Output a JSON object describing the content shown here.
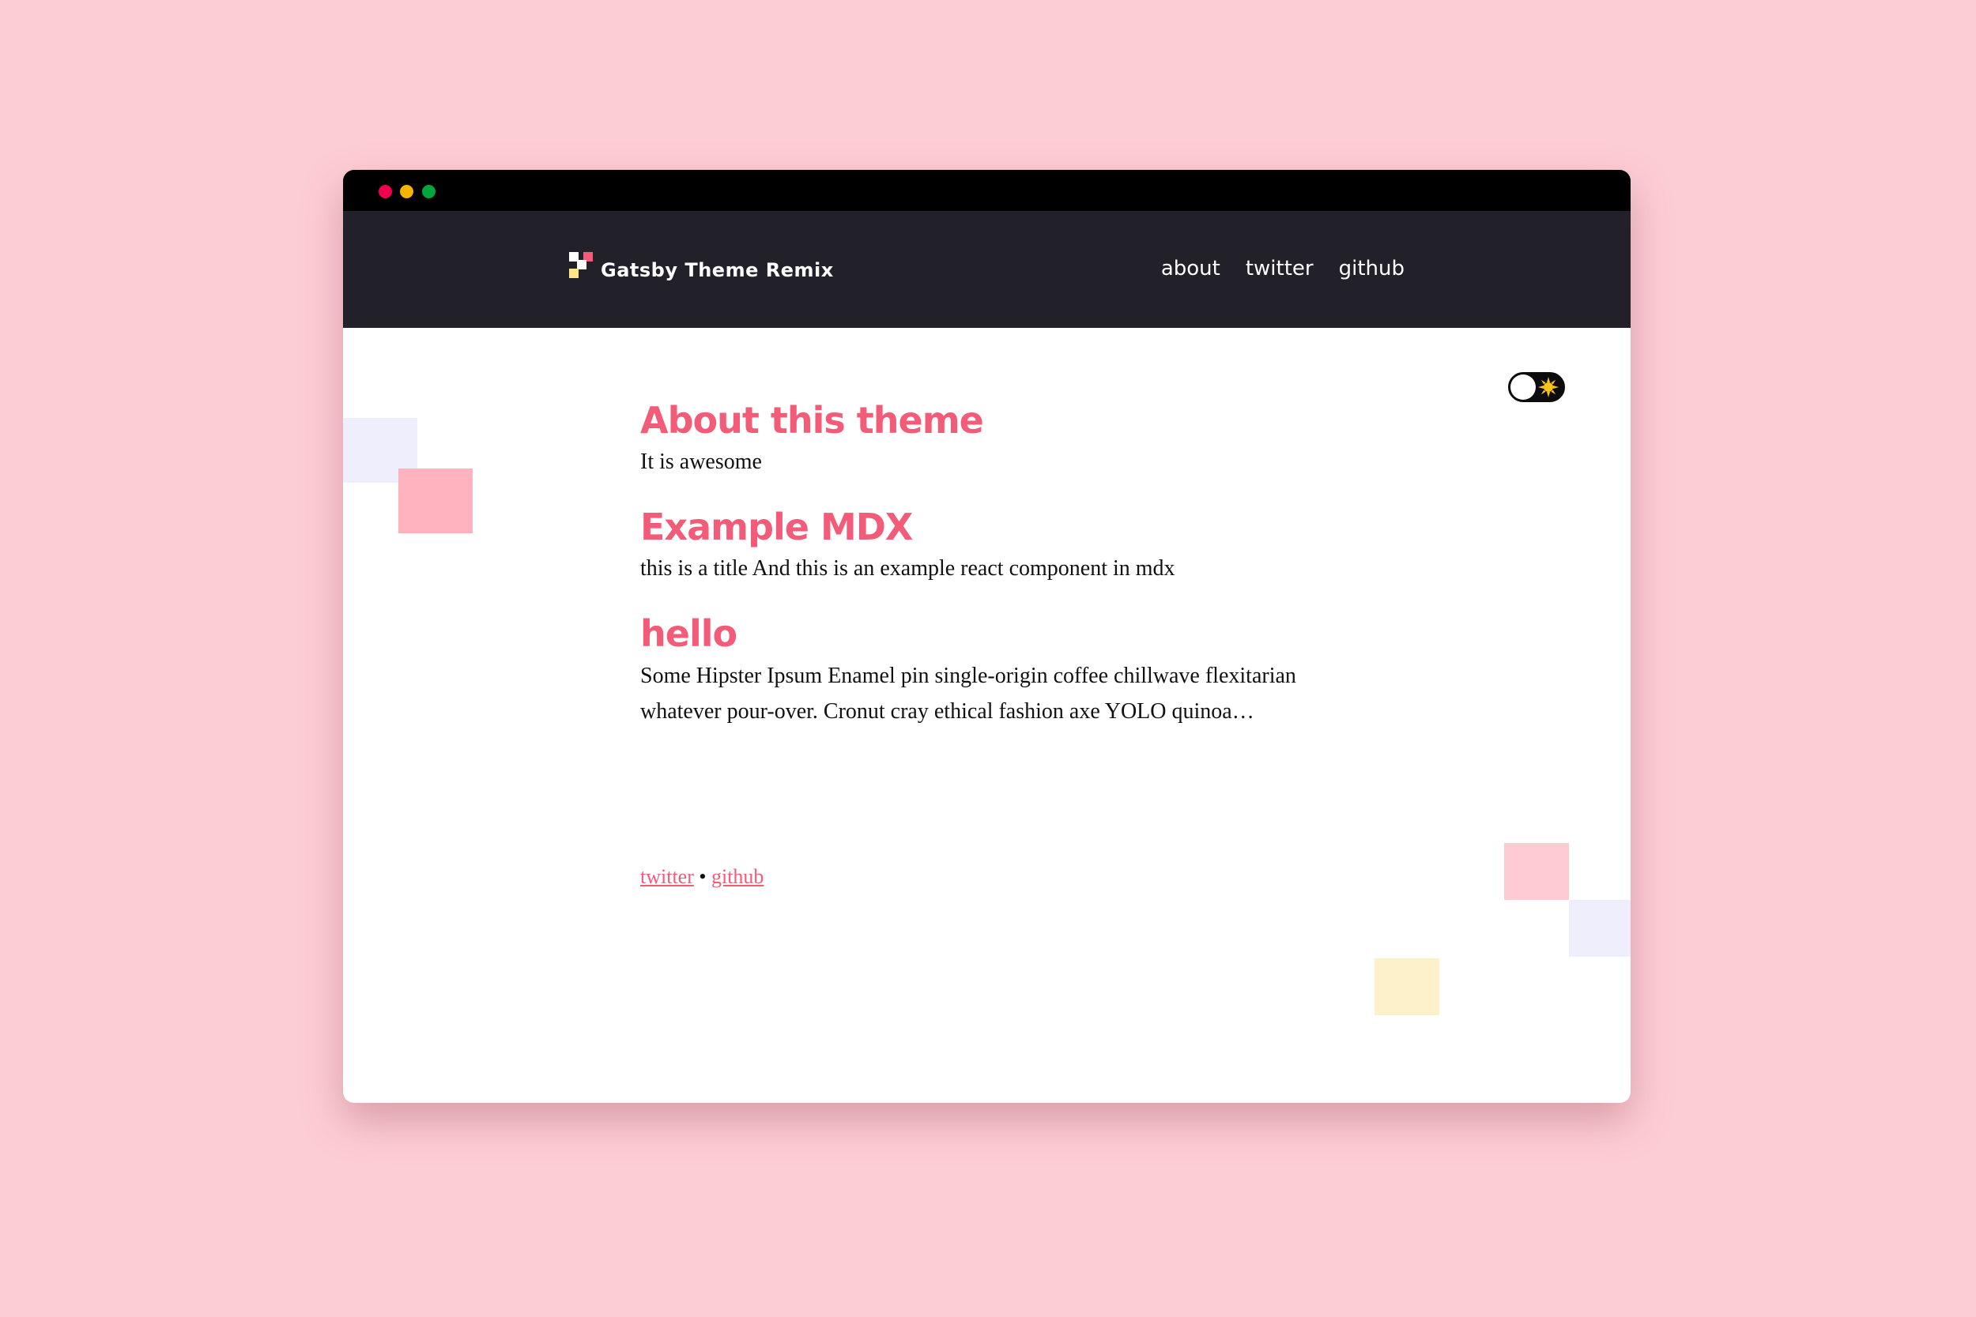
{
  "colors": {
    "page_background": "#fdcdd4",
    "header_background": "#222129",
    "accent": "#f25c78",
    "dot_red": "#f1004f",
    "dot_yellow": "#f5b400",
    "dot_green": "#00a63e",
    "deco_lavender": "#efeefd",
    "deco_pink": "#ffb3bf",
    "deco_light_pink": "#ffcbd2",
    "deco_cream": "#fdf1cc",
    "logo_white": "#ffffff",
    "logo_pink": "#f25c78",
    "logo_yellow": "#fde68a",
    "sun": "#fcc419"
  },
  "header": {
    "logo_icon": "pixel-logo-icon",
    "title": "Gatsby Theme Remix",
    "nav": [
      {
        "label": "about"
      },
      {
        "label": "twitter"
      },
      {
        "label": "github"
      }
    ]
  },
  "toggle": {
    "icon": "sun-icon",
    "state": "light"
  },
  "posts": [
    {
      "title": "About this theme",
      "excerpt": "It is awesome"
    },
    {
      "title": "Example MDX",
      "excerpt": "this is a title And this is an example react component in mdx"
    },
    {
      "title": "hello",
      "excerpt": "Some Hipster Ipsum Enamel pin single-origin coffee chillwave flexitarian whatever pour-over. Cronut cray ethical fashion axe YOLO quinoa…"
    }
  ],
  "footer": {
    "twitter_label": "twitter",
    "separator": "•",
    "github_label": "github"
  }
}
